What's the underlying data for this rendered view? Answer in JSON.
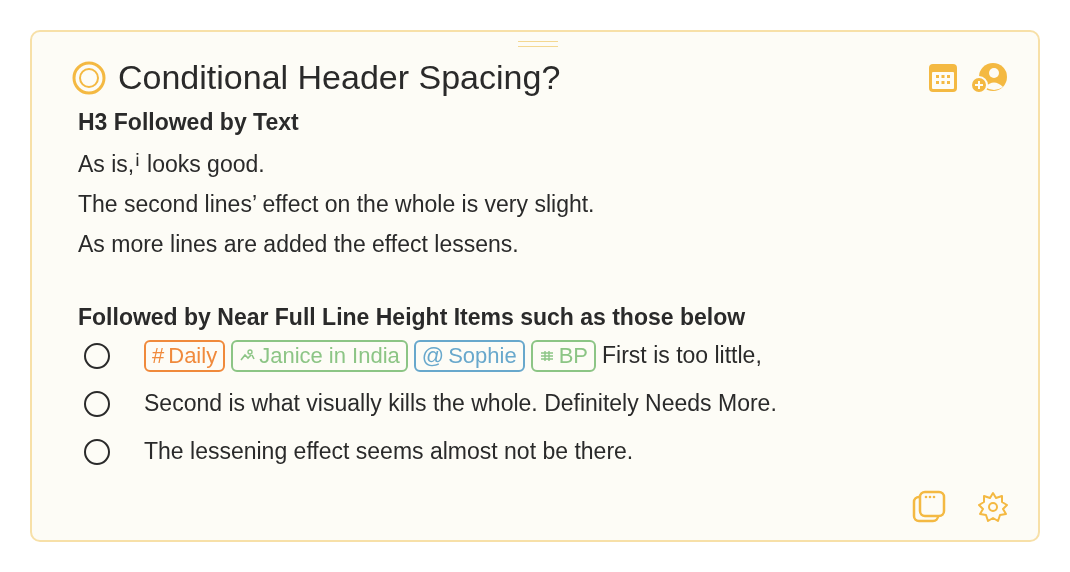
{
  "title": "Conditional Header Spacing?",
  "sections": [
    {
      "heading": "H3 Followed by Text",
      "lines": [
        "As is,$^{¡}$ looks good.",
        "The second lines’ effect on the whole is very slight.",
        "As more lines are added the effect lessens."
      ]
    },
    {
      "heading": "Followed by Near Full Line Height Items such as those below"
    }
  ],
  "tasks": [
    {
      "checked": false,
      "tags": [
        {
          "kind": "hashtag",
          "symbol": "#",
          "label": "Daily",
          "color": "#f08a3c"
        },
        {
          "kind": "area",
          "label": "Janice in India",
          "color": "#8cc585"
        },
        {
          "kind": "mention",
          "symbol": "@",
          "label": "Sophie",
          "color": "#68a8cc"
        },
        {
          "kind": "project",
          "label": "BP",
          "color": "#8cc585"
        }
      ],
      "text": "First is too little,"
    },
    {
      "checked": false,
      "text": "Second is what visually kills the whole. Definitely Needs More."
    },
    {
      "checked": false,
      "text": "The lessening effect seems almost not be there."
    }
  ]
}
